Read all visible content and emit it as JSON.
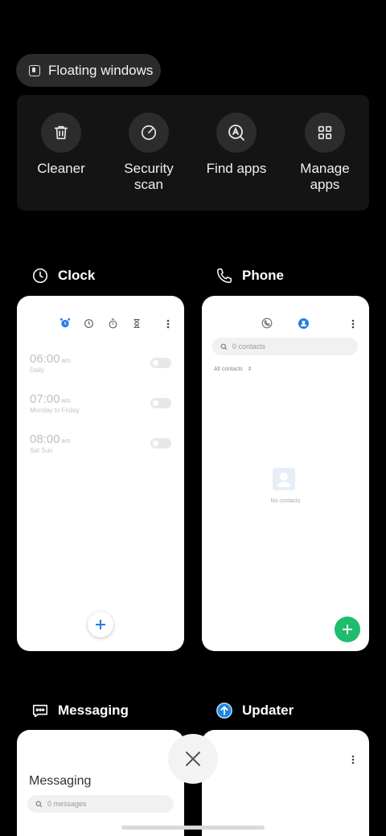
{
  "floating_windows": {
    "label": "Floating windows"
  },
  "tools": [
    {
      "label": "Cleaner",
      "icon": "trash-icon"
    },
    {
      "label": "Security\nscan",
      "icon": "security-scan-icon"
    },
    {
      "label": "Find apps",
      "icon": "find-apps-icon"
    },
    {
      "label": "Manage\napps",
      "icon": "grid-icon"
    }
  ],
  "apps": {
    "clock": {
      "name": "Clock",
      "alarms": [
        {
          "time": "06:00",
          "ampm": "am",
          "sub": "Daily"
        },
        {
          "time": "07:00",
          "ampm": "am",
          "sub": "Monday to Friday"
        },
        {
          "time": "08:00",
          "ampm": "am",
          "sub": "Sat Sun"
        }
      ]
    },
    "phone": {
      "name": "Phone",
      "search_placeholder": "0 contacts",
      "filter": "All contacts",
      "empty": "No contacts"
    },
    "messaging": {
      "name": "Messaging",
      "title": "Messaging",
      "search_placeholder": "0 messages"
    },
    "updater": {
      "name": "Updater"
    }
  },
  "colors": {
    "accent_blue": "#2a7de1",
    "fab_green": "#1ebd6e",
    "updater_blue": "#1e88e5"
  }
}
